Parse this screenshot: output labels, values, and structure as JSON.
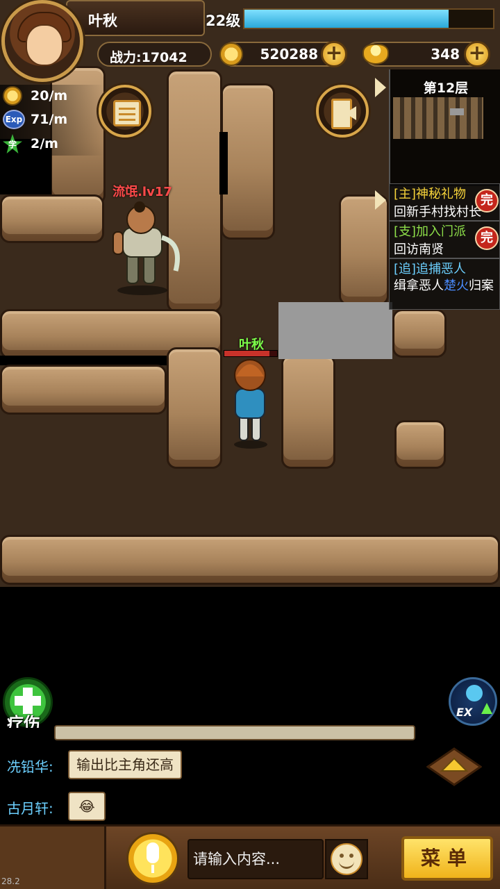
{
  "player": {
    "name": "叶秋",
    "level_label": "22级",
    "exp_progress": 0.82,
    "power_label": "战力:17042",
    "copper": "520288",
    "gold": "348"
  },
  "rates": [
    {
      "icon": "coin-icon",
      "value": "20/m"
    },
    {
      "icon": "exp-icon",
      "label": "Exp",
      "value": "71/m"
    },
    {
      "icon": "study-star-icon",
      "label": "学",
      "value": "2/m"
    }
  ],
  "minimap": {
    "floor_label": "第12层"
  },
  "quests": [
    {
      "tag": "[主]",
      "title": "神秘礼物",
      "desc": "回新手村找村长",
      "done": "完"
    },
    {
      "tag": "[支]",
      "title": "加入门派",
      "desc": "回访南贤",
      "done": "完"
    },
    {
      "tag": "[追]",
      "title": "追捕恶人",
      "desc_before": "缉拿恶人",
      "desc_highlight": "楚火",
      "desc_after": "归案"
    }
  ],
  "enemy": {
    "label": "流氓.lv17"
  },
  "hero": {
    "label": "叶秋"
  },
  "heal_button": {
    "label": "疗伤"
  },
  "ex_button": {
    "label": "EX"
  },
  "chat": [
    {
      "name": "冼铅华:",
      "message": "输出比主角还高"
    },
    {
      "name": "古月轩:",
      "message": "😂"
    }
  ],
  "input": {
    "placeholder": "请输入内容..."
  },
  "menu_button": {
    "label": "菜单"
  },
  "fps": "28.2",
  "colors": {
    "exp_bar": "#3fc0e8",
    "quest_main": "#f5d23a",
    "quest_side": "#8ee04a",
    "quest_chase": "#6cd0ff",
    "highlight": "#4a8cff"
  }
}
